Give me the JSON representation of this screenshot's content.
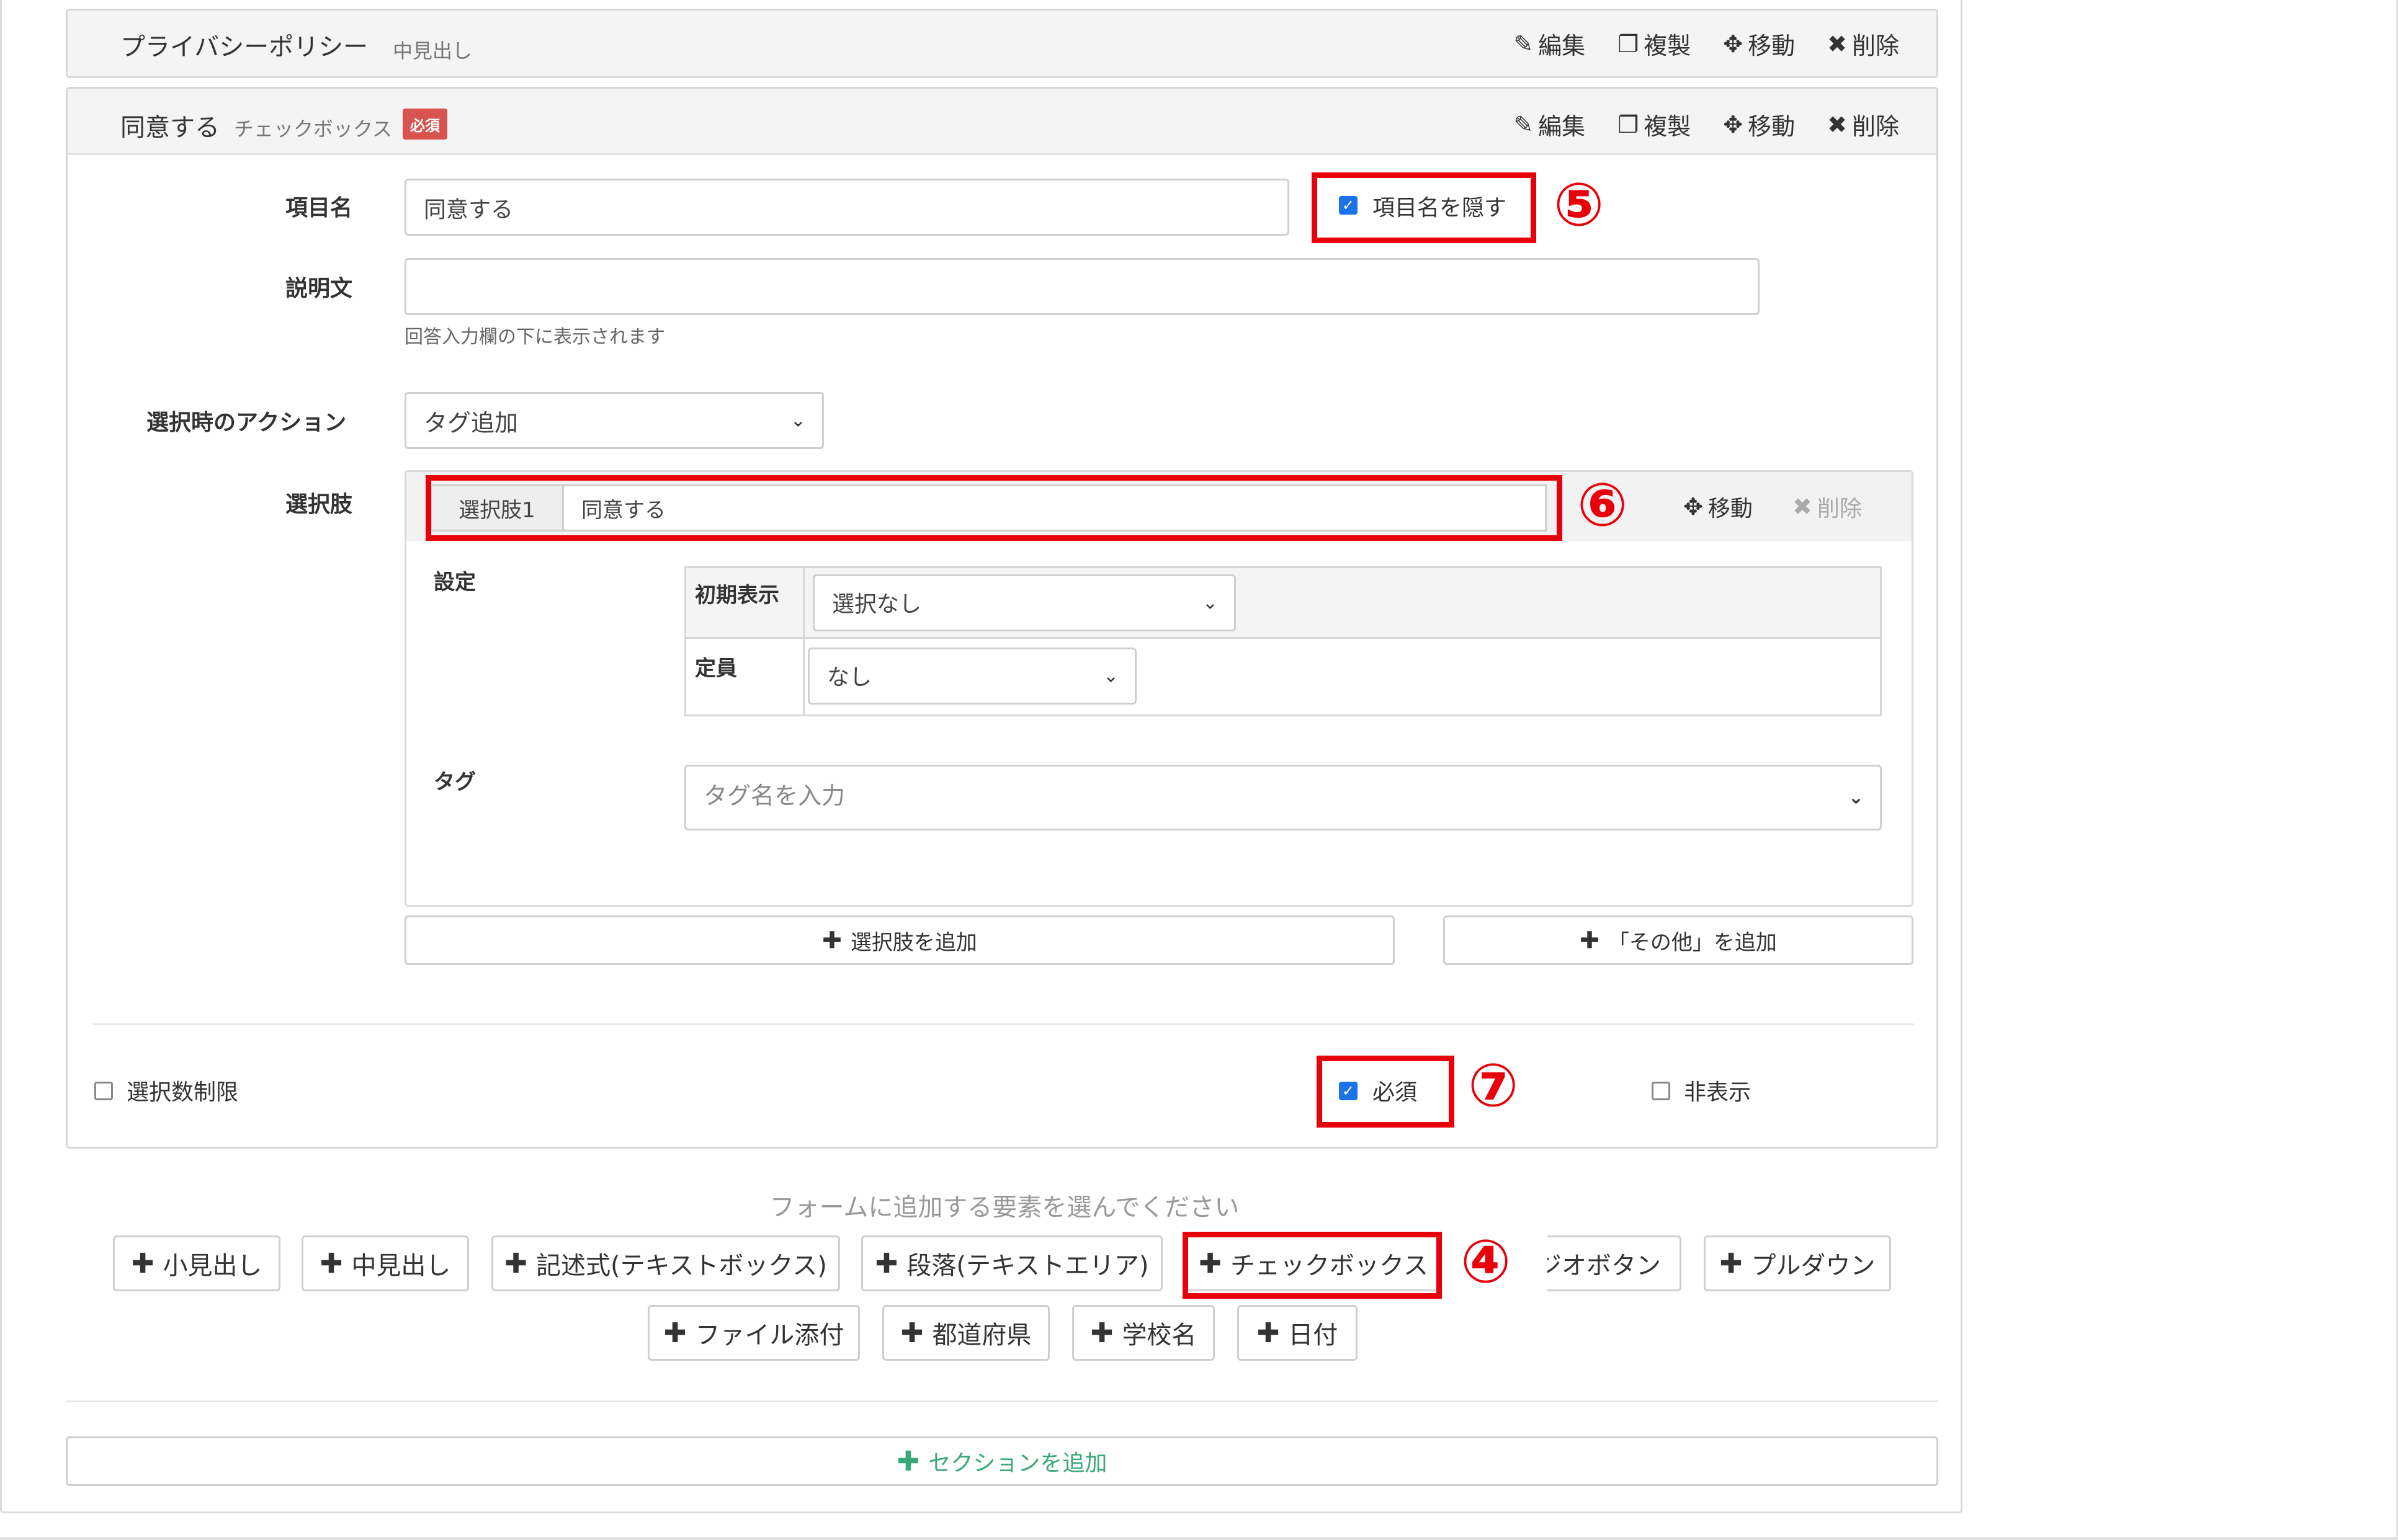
{
  "panels": {
    "privacy": {
      "title": "プライバシーポリシー",
      "type_label": "中見出し",
      "actions": {
        "edit": "編集",
        "edit_icon": "pencil-icon",
        "duplicate": "複製",
        "duplicate_icon": "copy-icon",
        "move": "移動",
        "move_icon": "move-arrows-icon",
        "delete": "削除",
        "delete_icon": "x-icon"
      }
    },
    "agree": {
      "title": "同意する",
      "type_label": "チェックボックス",
      "required_badge": "必須",
      "actions": {
        "edit": "編集",
        "duplicate": "複製",
        "move": "移動",
        "delete": "削除"
      }
    }
  },
  "form": {
    "item_name_label": "項目名",
    "item_name_value": "同意する",
    "hide_item_name_label": "項目名を隠す",
    "hide_item_name_checked": true,
    "description_label": "説明文",
    "description_value": "",
    "description_help": "回答入力欄の下に表示されます",
    "action_label": "選択時のアクション",
    "action_value": "タグ追加",
    "choices_label": "選択肢",
    "choice": {
      "addon": "選択肢1",
      "value": "同意する",
      "move": "移動",
      "delete": "削除"
    },
    "settings_label": "設定",
    "initial_display_label": "初期表示",
    "initial_display_value": "選択なし",
    "capacity_label": "定員",
    "capacity_value": "なし",
    "tag_label": "タグ",
    "tag_placeholder": "タグ名を入力",
    "add_choice": "選択肢を追加",
    "add_other": "「その他」を追加",
    "limit_selection_label": "選択数制限",
    "limit_selection_checked": false,
    "required_label": "必須",
    "required_checked": true,
    "hidden_label": "非表示",
    "hidden_checked": false
  },
  "add_elements": {
    "prompt": "フォームに追加する要素を選んでください",
    "buttons_row1": [
      "小見出し",
      "中見出し",
      "記述式(テキストボックス)",
      "段落(テキストエリア)",
      "チェックボックス",
      "ジオボタン",
      "プルダウン"
    ],
    "buttons_row2": [
      "ファイル添付",
      "都道府県",
      "学校名",
      "日付"
    ],
    "add_section": "セクションを追加"
  },
  "annotations": {
    "five": "⑤",
    "six": "⑥",
    "seven": "⑦",
    "four": "④"
  },
  "colors": {
    "highlight": "#e8000a",
    "required_badge": "#d9534f",
    "checkbox_checked": "#1a73e8",
    "add_section_text": "#3aa876"
  }
}
